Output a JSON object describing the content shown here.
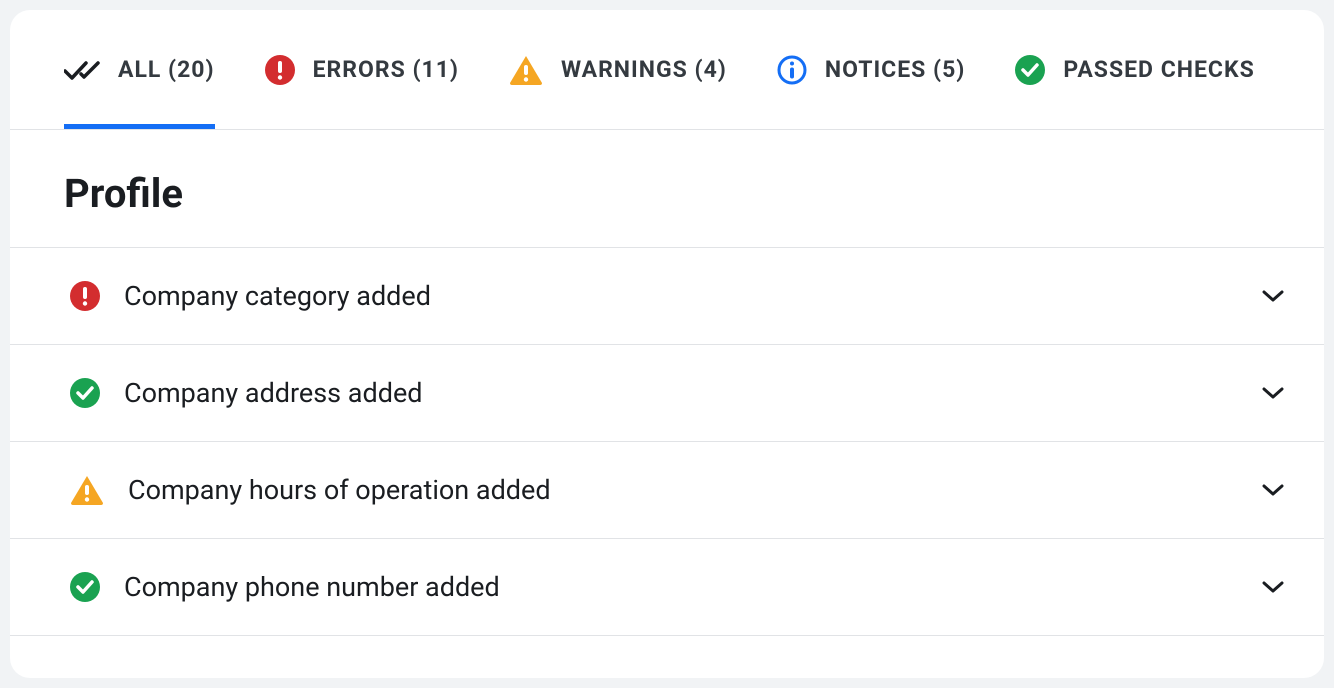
{
  "tabs": {
    "all": {
      "label": "ALL (20)"
    },
    "errors": {
      "label": "ERRORS (11)"
    },
    "warnings": {
      "label": "WARNINGS (4)"
    },
    "notices": {
      "label": "NOTICES (5)"
    },
    "passed": {
      "label": "PASSED CHECKS"
    }
  },
  "section": {
    "title": "Profile"
  },
  "checks": [
    {
      "status": "error",
      "label": "Company category added"
    },
    {
      "status": "success",
      "label": "Company address added"
    },
    {
      "status": "warning",
      "label": "Company hours of operation added"
    },
    {
      "status": "success",
      "label": "Company phone number added"
    }
  ]
}
